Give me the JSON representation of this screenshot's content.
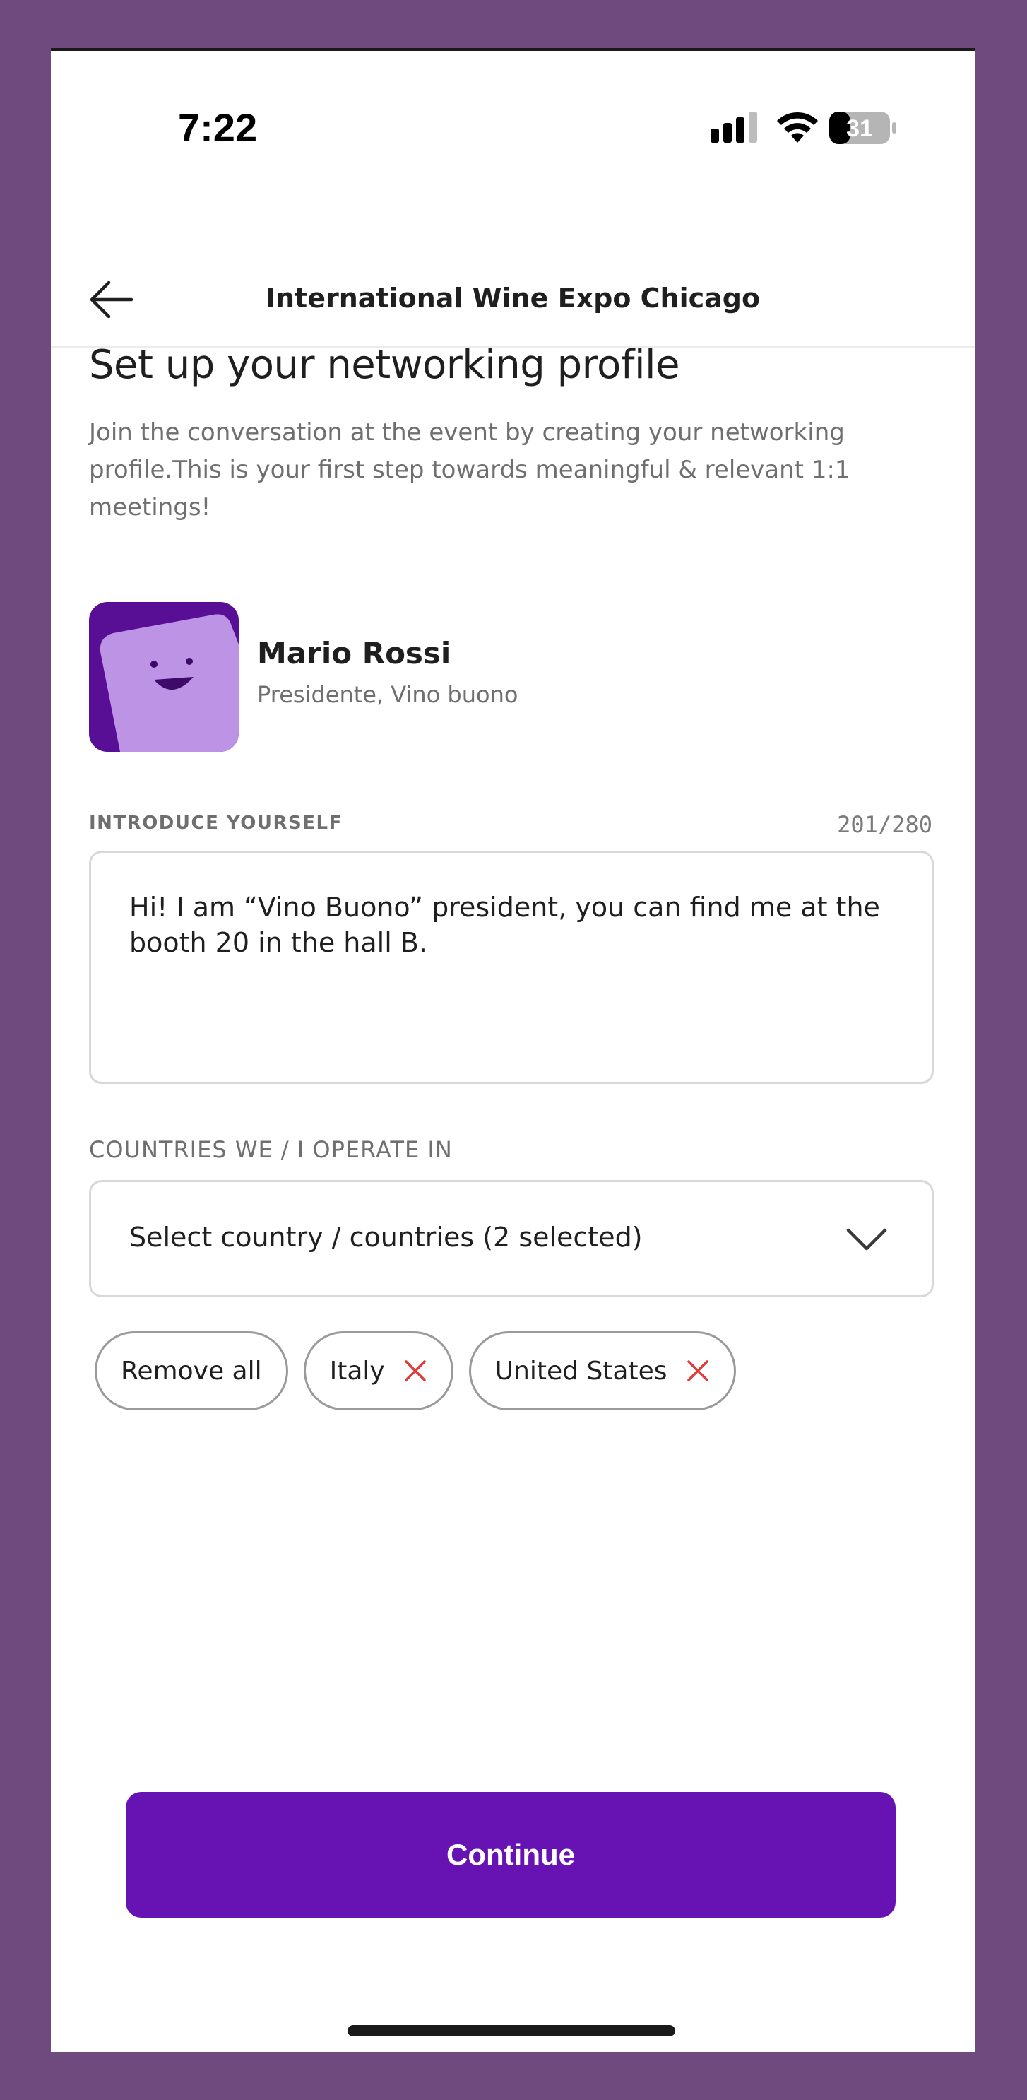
{
  "status_bar": {
    "time": "7:22",
    "battery_level": "31"
  },
  "header": {
    "title": "International Wine Expo Chicago",
    "back_icon": "arrow-left-icon"
  },
  "page": {
    "title": "Set up your networking profile",
    "description": "Join the conversation at the event by creating your networking profile.This is your first step towards meaningful & relevant 1:1 meetings!"
  },
  "profile": {
    "name": "Mario Rossi",
    "role": "Presidente, Vino buono",
    "avatar_icon": "smiley-avatar-icon"
  },
  "introduce": {
    "label": "INTRODUCE YOURSELF",
    "counter": "201/280",
    "value": "Hi! I am “Vino Buono” president, you can find me at the booth 20 in the hall B."
  },
  "countries": {
    "label": "COUNTRIES WE / I OPERATE IN",
    "select_text": "Select country / countries (2 selected)",
    "remove_all_label": "Remove all",
    "selected": [
      "Italy",
      "United States"
    ]
  },
  "continue_label": "Continue",
  "colors": {
    "primary": "#6713b3",
    "avatar_bg": "#580f96",
    "avatar_fg": "#bd93e6",
    "remove_x": "#e03a3a"
  }
}
